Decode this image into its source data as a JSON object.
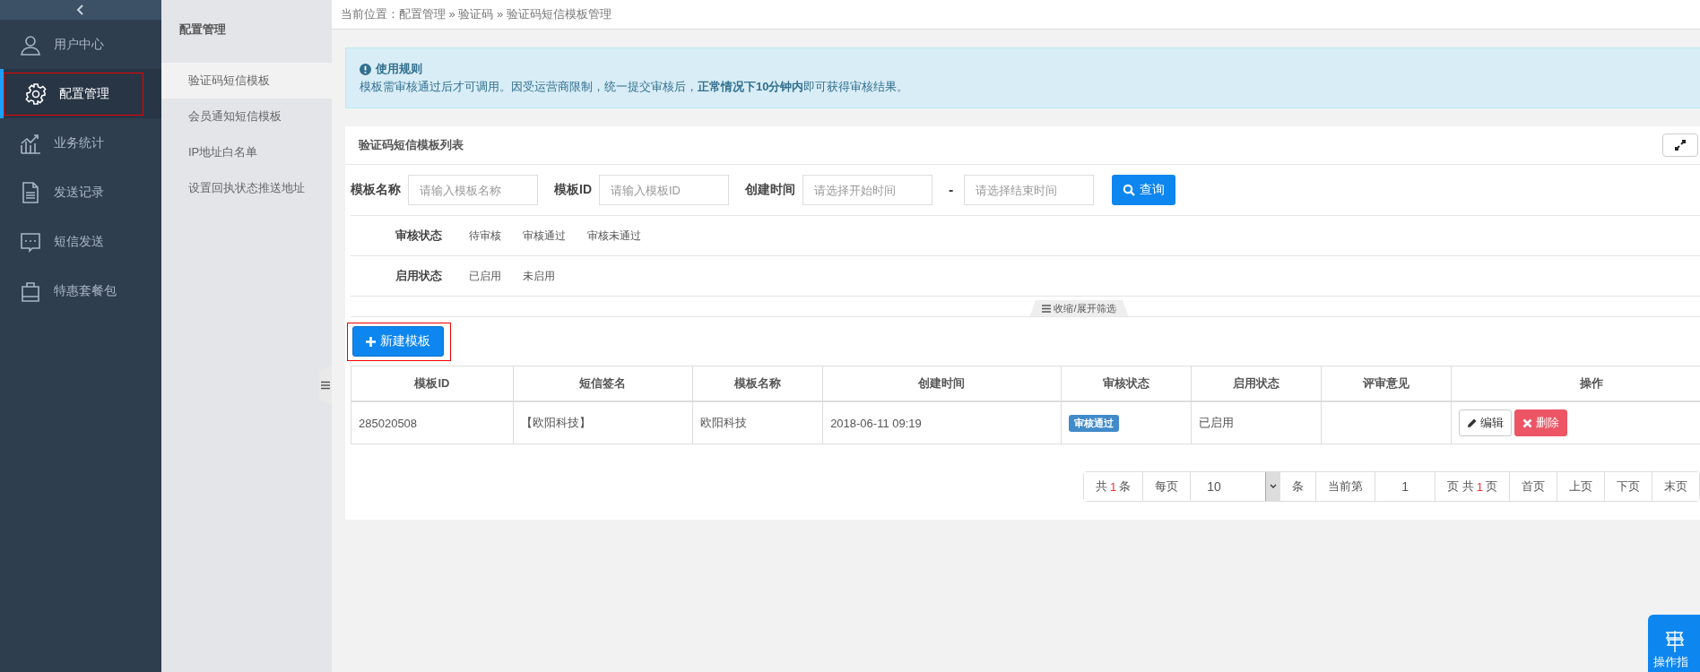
{
  "sidebar": {
    "items": [
      {
        "label": "用户中心",
        "selected": false
      },
      {
        "label": "配置管理",
        "selected": true
      },
      {
        "label": "业务统计",
        "selected": false
      },
      {
        "label": "发送记录",
        "selected": false
      },
      {
        "label": "短信发送",
        "selected": false
      },
      {
        "label": "特惠套餐包",
        "selected": false
      }
    ]
  },
  "subnav": {
    "title": "配置管理",
    "items": [
      {
        "label": "验证码短信模板",
        "selected": true
      },
      {
        "label": "会员通知短信模板",
        "selected": false
      },
      {
        "label": "IP地址白名单",
        "selected": false
      },
      {
        "label": "设置回执状态推送地址",
        "selected": false
      }
    ]
  },
  "breadcrumb": "当前位置：配置管理 » 验证码 » 验证码短信模板管理",
  "notice": {
    "title": "使用规则",
    "text": "模板需审核通过后才可调用。因受运营商限制，统一提交审核后，**正常情况下10分钟内**即可获得审核结果。"
  },
  "panel": {
    "title": "验证码短信模板列表",
    "filters": [
      {
        "label": "模板名称",
        "placeholder": "请输入模板名称"
      },
      {
        "label": "模板ID",
        "placeholder": "请输入模板ID"
      }
    ],
    "date_range": {
      "label": "创建时间",
      "start_placeholder": "请选择开始时间",
      "separator": "-",
      "end_placeholder": "请选择结束时间"
    },
    "search_button": "查询",
    "status_filters": [
      {
        "label": "审核状态",
        "options": [
          "待审核",
          "审核通过",
          "审核未通过"
        ]
      },
      {
        "label": "启用状态",
        "options": [
          "已启用",
          "未启用"
        ]
      }
    ],
    "toggle_filters": "收缩/展开筛选",
    "new_button": "新建模板",
    "table": {
      "columns": [
        "模板ID",
        "短信签名",
        "模板名称",
        "创建时间",
        "审核状态",
        "启用状态",
        "评审意见",
        "操作"
      ],
      "rows": [
        {
          "template_id": "285020508",
          "signature": "【欧阳科技】",
          "name": "欧阳科技",
          "created": "2018-06-11 09:19",
          "review_status": "审核通过",
          "enabled_status": "已启用",
          "actions": [
            {
              "kind": "edit",
              "label": "编辑"
            },
            {
              "kind": "delete",
              "label": "删除"
            }
          ]
        }
      ]
    },
    "pagination": {
      "total_prefix": "共",
      "total": "1",
      "total_suffix": "条",
      "per_page_label": "每页",
      "per_page": "10",
      "unit": "条",
      "current_label": "当前第",
      "current_page": "1",
      "pages_prefix": "页 共",
      "pages": "1",
      "pages_suffix": "页",
      "buttons": [
        "首页",
        "上页",
        "下页",
        "末页"
      ]
    }
  },
  "guide_button": "操作指"
}
